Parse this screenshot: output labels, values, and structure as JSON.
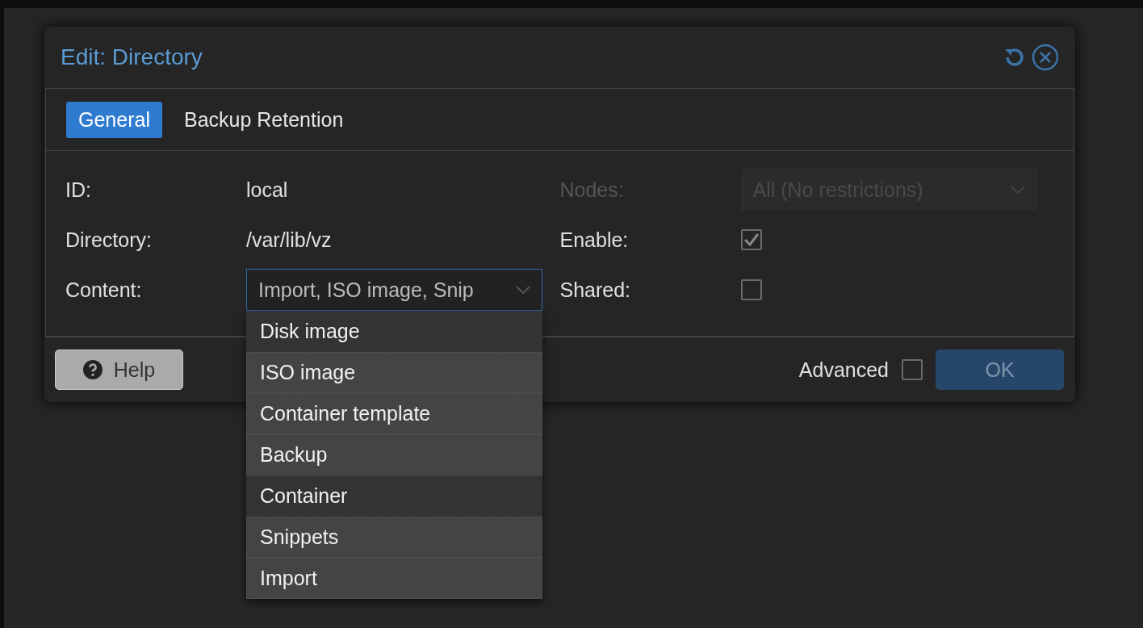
{
  "dialog": {
    "title": "Edit: Directory"
  },
  "tabs": [
    {
      "label": "General",
      "selected": true
    },
    {
      "label": "Backup Retention",
      "selected": false
    }
  ],
  "fields_left": [
    {
      "kind": "text",
      "label": "ID:",
      "value": "local"
    },
    {
      "kind": "text",
      "label": "Directory:",
      "value": "/var/lib/vz"
    },
    {
      "kind": "select",
      "label": "Content:",
      "value": "Import, ISO image, Snip",
      "expanded": true,
      "disabled": false
    }
  ],
  "fields_right": [
    {
      "kind": "select",
      "label": "Nodes:",
      "value": "All (No restrictions)",
      "disabled": true,
      "expanded": false
    },
    {
      "kind": "checkbox",
      "label": "Enable:",
      "checked": true
    },
    {
      "kind": "checkbox",
      "label": "Shared:",
      "checked": false
    }
  ],
  "dropdown": [
    {
      "label": "Disk image",
      "selected": false
    },
    {
      "label": "ISO image",
      "selected": true
    },
    {
      "label": "Container template",
      "selected": true
    },
    {
      "label": "Backup",
      "selected": true
    },
    {
      "label": "Container",
      "selected": false
    },
    {
      "label": "Snippets",
      "selected": true
    },
    {
      "label": "Import",
      "selected": true
    }
  ],
  "footer": {
    "help": "Help",
    "advanced": {
      "label": "Advanced",
      "checked": false
    },
    "ok": "OK"
  }
}
